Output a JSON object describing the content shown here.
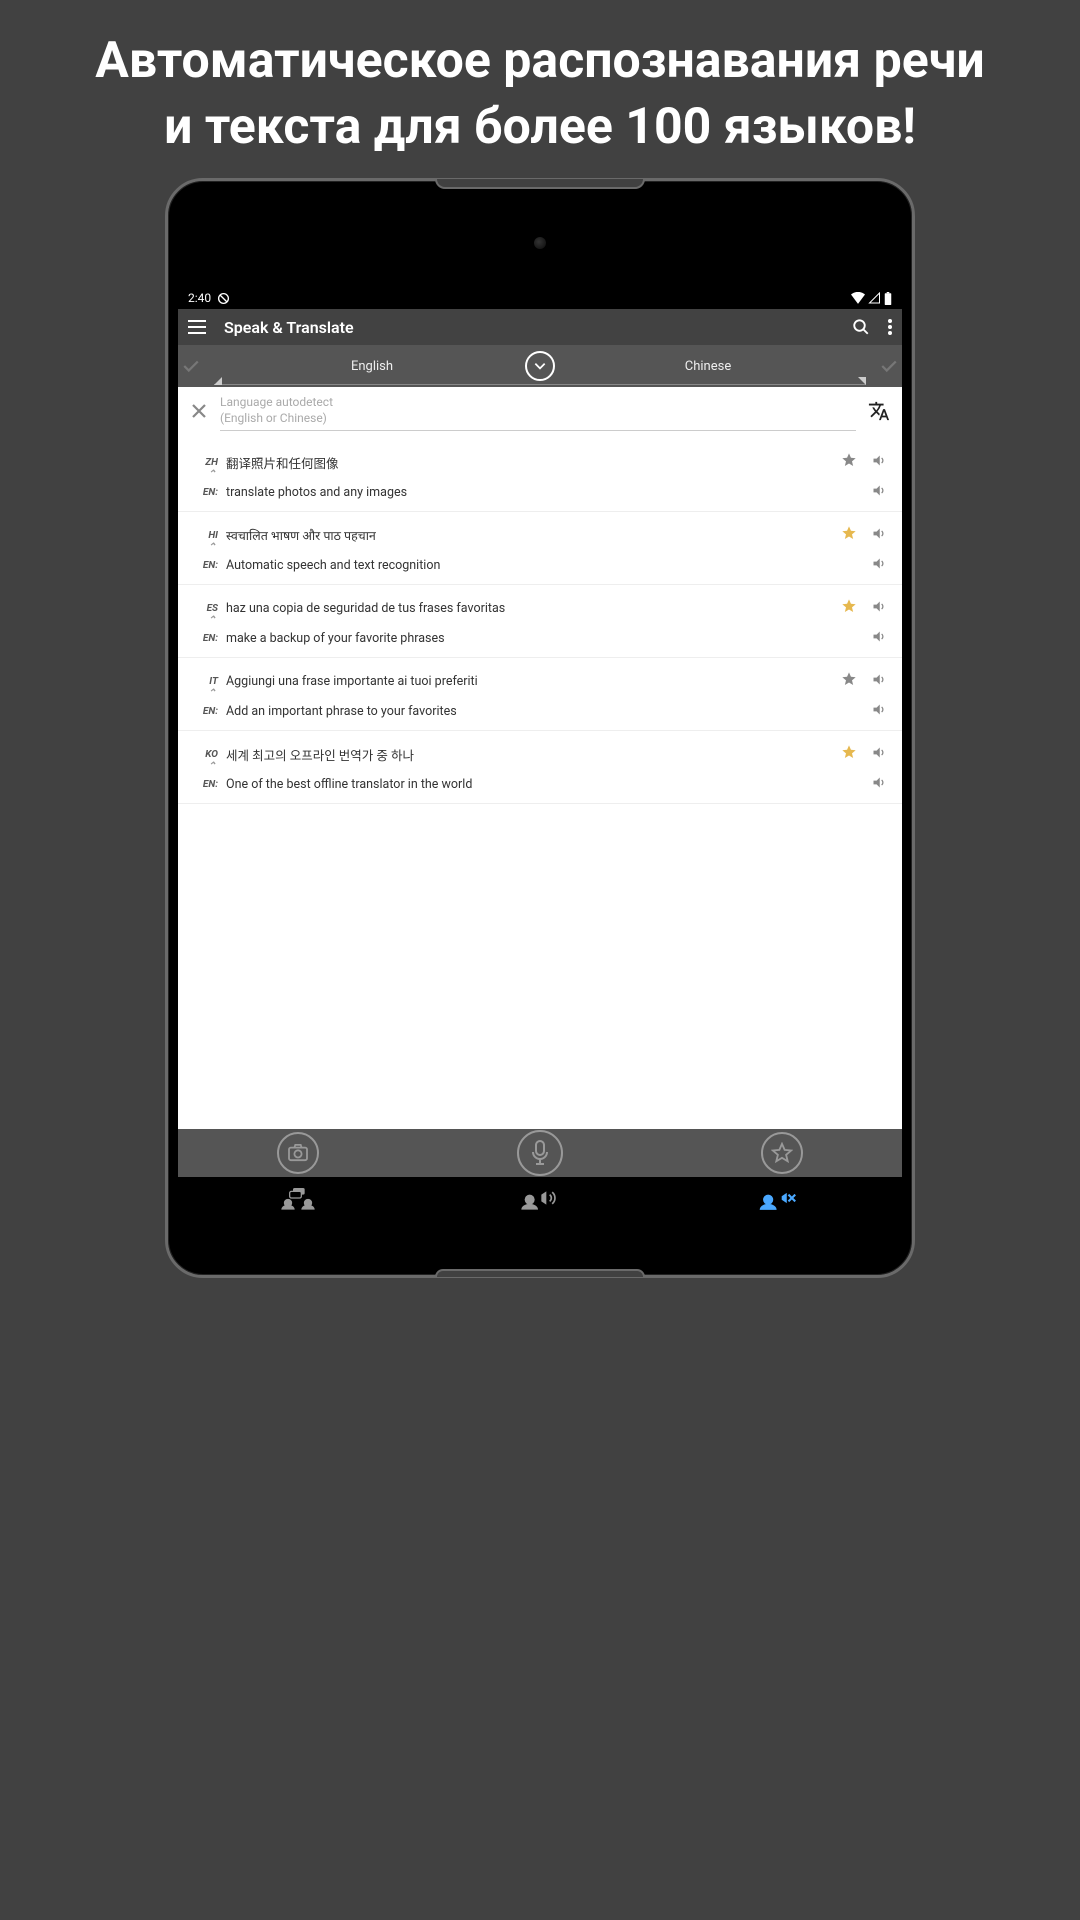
{
  "promo": {
    "headline": "Автоматическое распознавания речи и текста для более 100 языков!"
  },
  "status": {
    "time": "2:40"
  },
  "app": {
    "title": "Speak & Translate"
  },
  "langs": {
    "left": "English",
    "right": "Chinese"
  },
  "input": {
    "placeholder_line1": "Language autodetect",
    "placeholder_line2": "(English or Chinese)"
  },
  "entries": [
    {
      "src_tag": "ZH",
      "src_text": "翻译照片和任何图像",
      "en_text": "translate photos and any images",
      "fav": false
    },
    {
      "src_tag": "HI",
      "src_text": "स्वचालित भाषण और पाठ पहचान",
      "en_text": "Automatic speech and text recognition",
      "fav": true
    },
    {
      "src_tag": "ES",
      "src_text": "haz una copia de seguridad de tus frases favoritas",
      "en_text": "make a backup of your favorite phrases",
      "fav": true
    },
    {
      "src_tag": "IT",
      "src_text": "Aggiungi una frase importante ai tuoi preferiti",
      "en_text": "Add an important phrase to your favorites",
      "fav": false
    },
    {
      "src_tag": "KO",
      "src_text": "세계 최고의 오프라인 번역가 중 하나",
      "en_text": "One of the best offline translator in the world",
      "fav": true
    }
  ],
  "en_label": "EN:"
}
